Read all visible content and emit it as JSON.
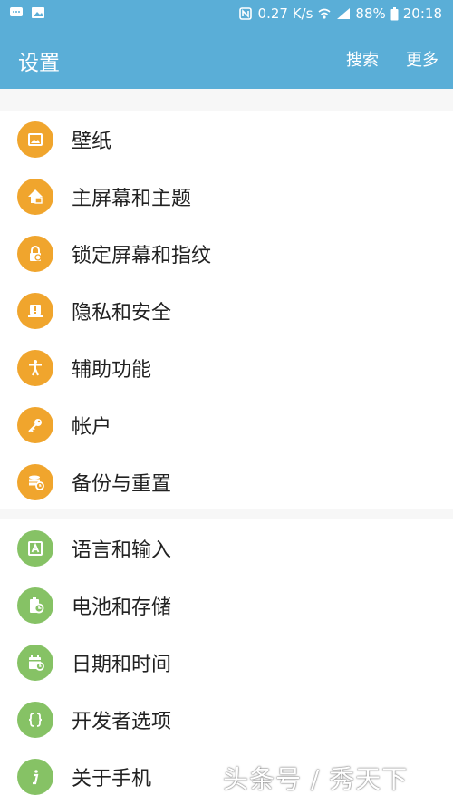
{
  "status": {
    "speed": "0.27 K/s",
    "battery": "88%",
    "time": "20:18",
    "left_icons": [
      "chat-icon",
      "image-icon"
    ],
    "right_icons": [
      "nfc-icon",
      "wifi-icon",
      "signal-icon",
      "battery-icon"
    ]
  },
  "appbar": {
    "title": "设置",
    "search_label": "搜索",
    "more_label": "更多",
    "color": "#5aaed7"
  },
  "colors": {
    "orange": "#f0a52d",
    "green": "#86c265"
  },
  "sections": [
    {
      "items": [
        {
          "label": "壁纸",
          "icon": "wallpaper-icon"
        },
        {
          "label": "主屏幕和主题",
          "icon": "home-theme-icon"
        },
        {
          "label": "锁定屏幕和指纹",
          "icon": "lock-fingerprint-icon"
        },
        {
          "label": "隐私和安全",
          "icon": "privacy-shield-icon"
        },
        {
          "label": "辅助功能",
          "icon": "accessibility-icon"
        },
        {
          "label": "帐户",
          "icon": "key-icon"
        },
        {
          "label": "备份与重置",
          "icon": "backup-icon"
        }
      ]
    },
    {
      "items": [
        {
          "label": "语言和输入",
          "icon": "language-icon"
        },
        {
          "label": "电池和存储",
          "icon": "battery-storage-icon"
        },
        {
          "label": "日期和时间",
          "icon": "calendar-clock-icon"
        },
        {
          "label": "开发者选项",
          "icon": "braces-icon"
        },
        {
          "label": "关于手机",
          "icon": "info-icon"
        }
      ]
    }
  ],
  "watermark": "头条号 / 秀天下"
}
